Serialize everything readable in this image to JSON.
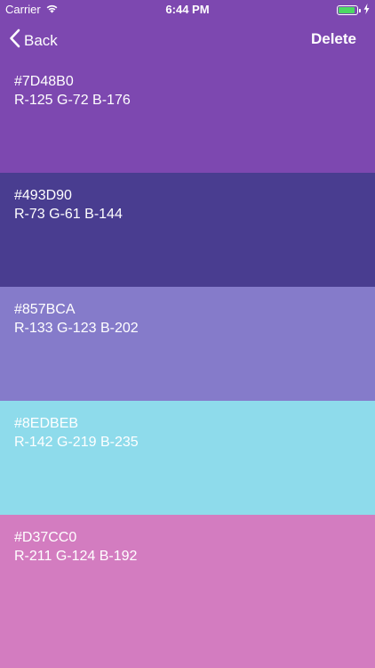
{
  "status_bar": {
    "carrier": "Carrier",
    "time": "6:44 PM",
    "battery_fill_color": "#4cd964",
    "battery_level_fraction": 0.9
  },
  "nav": {
    "back_label": "Back",
    "delete_label": "Delete"
  },
  "swatches": [
    {
      "hex": "#7D48B0",
      "rgb": "R-125 G-72 B-176",
      "color": "#7D48B0"
    },
    {
      "hex": "#493D90",
      "rgb": "R-73 G-61 B-144",
      "color": "#493D90"
    },
    {
      "hex": "#857BCA",
      "rgb": "R-133 G-123 B-202",
      "color": "#857BCA"
    },
    {
      "hex": "#8EDBEB",
      "rgb": "R-142 G-219 B-235",
      "color": "#8EDBEB"
    },
    {
      "hex": "#D37CC0",
      "rgb": "R-211 G-124 B-192",
      "color": "#D37CC0"
    }
  ]
}
